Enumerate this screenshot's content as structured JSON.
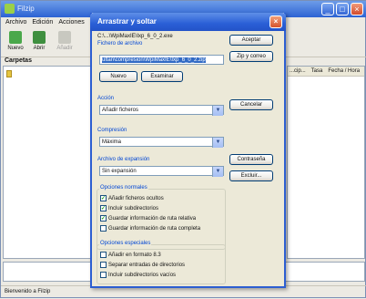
{
  "app": {
    "title": "Filzip",
    "menu": [
      "Archivo",
      "Edición",
      "Acciones"
    ],
    "toolbar": [
      "Nuevo",
      "Abrir",
      "Añadir"
    ],
    "folders_label": "Carpetas",
    "columns": [
      "...cip...",
      "Tasa",
      "Fecha / Hora"
    ],
    "status": "Bienvenido a Filzip",
    "window_buttons": [
      "_",
      "□",
      "×"
    ]
  },
  "dialog": {
    "title": "Arrastrar y soltar",
    "close": "×",
    "path_text": "C:\\...\\WpiMaxIE\\Ixp_6_0_2.exe",
    "archive_label": "Fichero de archivo",
    "archive_value": "ultan\\compresion\\WpiMaxIE\\Ixp_6_0_2.zip",
    "buttons": {
      "new": "Nuevo",
      "browse": "Examinar",
      "accept": "Aceptar",
      "zip_email": "Zip y correo",
      "cancel": "Cancelar",
      "password": "Contraseña",
      "exclude": "Excluir..."
    },
    "action_label": "Acción",
    "action_value": "Añadir ficheros",
    "compression_label": "Compresión",
    "compression_value": "Máxima",
    "expansion_label": "Archivo de expansión",
    "expansion_value": "Sin expansión",
    "normal_options_label": "Opciones normales",
    "normal_options": [
      {
        "label": "Añadir ficheros ocultos",
        "checked": true
      },
      {
        "label": "Incluir subdirectorios",
        "checked": true
      },
      {
        "label": "Guardar información de ruta relativa",
        "checked": true
      },
      {
        "label": "Guardar información de ruta completa",
        "checked": false
      }
    ],
    "special_options_label": "Opciones especiales",
    "special_options": [
      {
        "label": "Añadir en formato 8.3",
        "checked": false
      },
      {
        "label": "Separar entradas de directorios",
        "checked": false
      },
      {
        "label": "Incluir subdirectorios vacíos",
        "checked": false
      }
    ]
  }
}
